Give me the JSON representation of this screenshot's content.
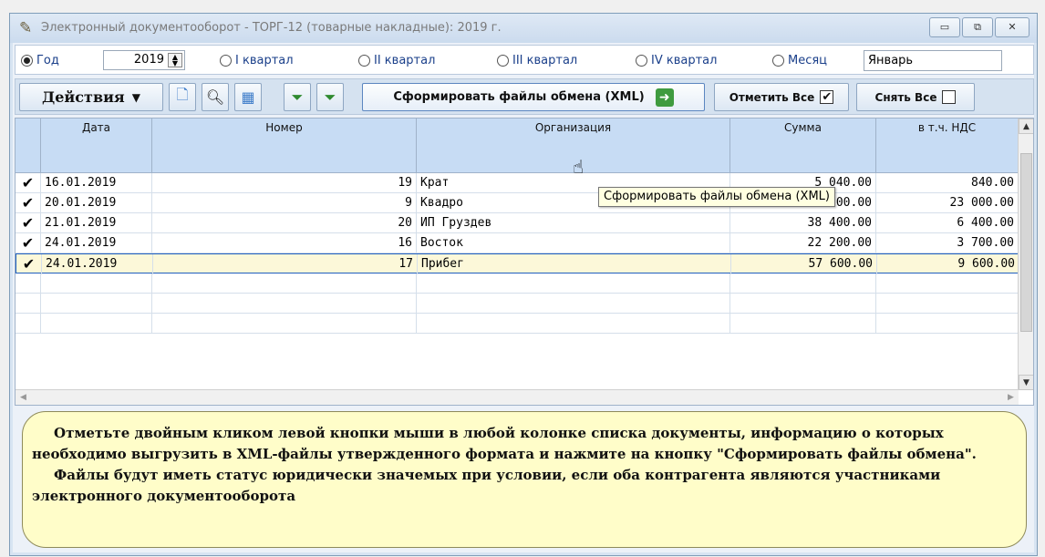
{
  "window": {
    "title": "Электронный документооборот - ТОРГ-12 (товарные накладные): 2019 г.",
    "buttons": [
      "▭",
      "⧉",
      "✕"
    ]
  },
  "period": {
    "year_label": "Год",
    "year_value": "2019",
    "q1": "I квартал",
    "q2": "II квартал",
    "q3": "III квартал",
    "q4": "IV квартал",
    "month_label": "Месяц",
    "month_value": "Январь",
    "selected": "Год"
  },
  "toolbar": {
    "actions_label": "Действия",
    "generate_label": "Сформировать файлы обмена (XML)",
    "mark_all_label": "Отметить Все",
    "unmark_all_label": "Снять Все",
    "icons": [
      "new-document-icon",
      "search-icon",
      "calendar-icon",
      "filter-add-icon",
      "filter-clear-icon"
    ]
  },
  "grid": {
    "columns": [
      "",
      "Дата",
      "Номер",
      "Организация",
      "Сумма",
      "в т.ч. НДС"
    ],
    "rows": [
      {
        "checked": "✔",
        "date": "16.01.2019",
        "number": "19",
        "org": "Крат",
        "sum": "5 040.00",
        "vat": "840.00"
      },
      {
        "checked": "✔",
        "date": "20.01.2019",
        "number": "9",
        "org": "Квадро",
        "sum": "138 000.00",
        "vat": "23 000.00"
      },
      {
        "checked": "✔",
        "date": "21.01.2019",
        "number": "20",
        "org": "ИП Груздев",
        "sum": "38 400.00",
        "vat": "6 400.00"
      },
      {
        "checked": "✔",
        "date": "24.01.2019",
        "number": "16",
        "org": "Восток",
        "sum": "22 200.00",
        "vat": "3 700.00"
      },
      {
        "checked": "✔",
        "date": "24.01.2019",
        "number": "17",
        "org": "Прибег",
        "sum": "57 600.00",
        "vat": "9 600.00"
      }
    ]
  },
  "tooltip": "Сформировать файлы обмена (XML)",
  "hint": {
    "p1": "Отметьте двойным кликом левой кнопки мыши в любой колонке списка документы,  информацию о которых необходимо выгрузить в XML-файлы утвержденного формата и нажмите на кнопку \"Сформировать файлы обмена\".",
    "p2": "Файлы будут иметь статус юридически значемых при условии, если оба контрагента являются участниками электронного документооборота"
  }
}
